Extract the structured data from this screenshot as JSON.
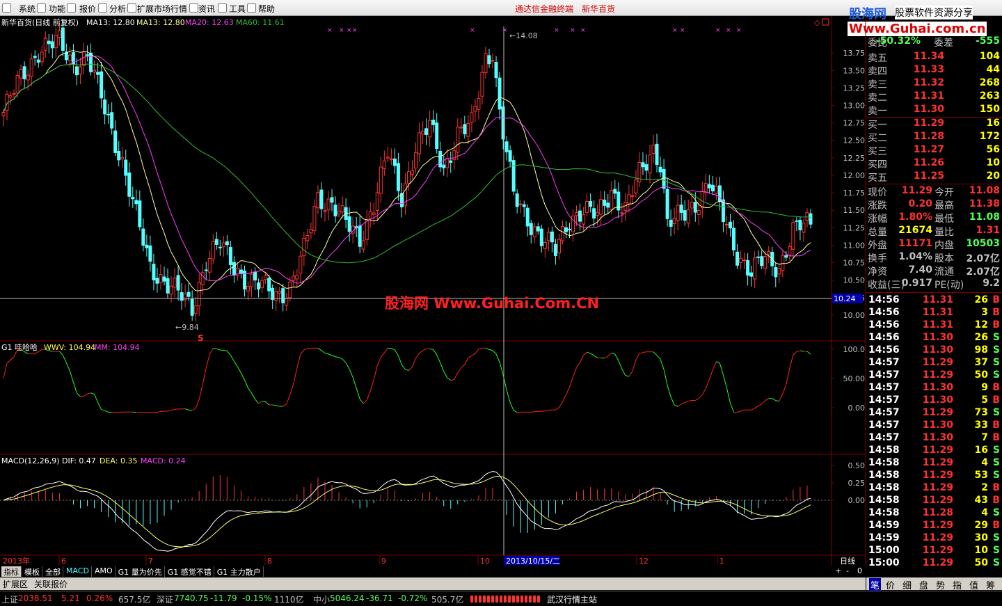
{
  "menu": {
    "items": [
      "系统",
      "功能",
      "报价",
      "分析",
      "扩展市场行情",
      "资讯",
      "工具",
      "帮助"
    ],
    "title": "通达信金融终端　新华百货"
  },
  "logo": {
    "brand": "股海网",
    "tag": "股票软件资源分享",
    "url": "Www.Guhai.com.cn",
    "watermark": "股海网 Www.Guhai.Com.CN"
  },
  "main_legend": {
    "stock": "新华百货(日线 前复权)",
    "ma1": "MA13: 12.80",
    "ma2": "MA13: 12.80",
    "ma3": "MA20: 12.63",
    "ma4": "MA60: 11.61"
  },
  "main_axis": [
    "13.75",
    "13.50",
    "13.25",
    "13.00",
    "12.75",
    "12.50",
    "12.25",
    "12.00",
    "11.75",
    "11.50",
    "11.25",
    "11.00",
    "10.75",
    "10.50",
    "10.25",
    "10.00"
  ],
  "main_marks": {
    "high": "14.08",
    "low": "9.84",
    "cross": "10.24",
    "s_sign": "S"
  },
  "ind1_legend": {
    "name": "G1 哇哈哈",
    "wwv": "WWV: 104.94",
    "mm": "MM: 104.94"
  },
  "ind1_axis": [
    "100.0",
    "50.00",
    "0.00"
  ],
  "macd_legend": {
    "name": "MACD(12,26,9)",
    "dif": "DIF: 0.47",
    "dea": "DEA: 0.35",
    "macd": "MACD: 0.24"
  },
  "macd_axis": [
    "0.50",
    "0.25",
    "0.00"
  ],
  "date_axis": {
    "year": "2013年",
    "months": [
      "6",
      "7",
      "8",
      "9",
      "10",
      "12",
      "1"
    ],
    "cursor": "2013/10/15/二",
    "period": "日线"
  },
  "tabs": [
    "指标",
    "模板",
    "全部",
    "MACD",
    "AMO",
    "G1 量为价先",
    "G1 感觉不错",
    "G1 主力散户"
  ],
  "tabs2": [
    "扩展区",
    "关联报价"
  ],
  "tab_controls": [
    "+",
    "-",
    "0"
  ],
  "quote": {
    "ratio": {
      "label": "委比",
      "value": "-50.32%",
      "label2": "委差",
      "value2": "-555"
    },
    "sells": [
      {
        "label": "卖五",
        "price": "11.34",
        "vol": "104"
      },
      {
        "label": "卖四",
        "price": "11.33",
        "vol": "44"
      },
      {
        "label": "卖三",
        "price": "11.32",
        "vol": "268"
      },
      {
        "label": "卖二",
        "price": "11.31",
        "vol": "263"
      },
      {
        "label": "卖一",
        "price": "11.30",
        "vol": "150"
      }
    ],
    "buys": [
      {
        "label": "买一",
        "price": "11.29",
        "vol": "16"
      },
      {
        "label": "买二",
        "price": "11.28",
        "vol": "172"
      },
      {
        "label": "买三",
        "price": "11.27",
        "vol": "56"
      },
      {
        "label": "买四",
        "price": "11.26",
        "vol": "10"
      },
      {
        "label": "买五",
        "price": "11.25",
        "vol": "20"
      }
    ],
    "stats": [
      {
        "l1": "现价",
        "v1": "11.29",
        "l2": "今开",
        "v2": "11.08"
      },
      {
        "l1": "涨跌",
        "v1": "0.20",
        "l2": "最高",
        "v2": "11.38"
      },
      {
        "l1": "涨幅",
        "v1": "1.80%",
        "l2": "最低",
        "v2": "11.08"
      },
      {
        "l1": "总量",
        "v1": "21674",
        "l2": "量比",
        "v2": "1.31"
      },
      {
        "l1": "外盘",
        "v1": "11171",
        "l2": "内盘",
        "v2": "10503"
      },
      {
        "l1": "换手",
        "v1": "1.04%",
        "l2": "股本",
        "v2": "2.07亿"
      },
      {
        "l1": "净资",
        "v1": "7.40",
        "l2": "流通",
        "v2": "2.07亿"
      },
      {
        "l1": "收益(三)",
        "v1": "0.917",
        "l2": "PE(动)",
        "v2": "9.2"
      }
    ],
    "ticks": [
      [
        "14:56",
        "11.31",
        "26",
        "B"
      ],
      [
        "14:56",
        "11.31",
        "3",
        "B"
      ],
      [
        "14:56",
        "11.31",
        "12",
        "B"
      ],
      [
        "14:56",
        "11.30",
        "26",
        "S"
      ],
      [
        "14:56",
        "11.30",
        "98",
        "S"
      ],
      [
        "14:57",
        "11.29",
        "37",
        "S"
      ],
      [
        "14:57",
        "11.29",
        "50",
        "S"
      ],
      [
        "14:57",
        "11.30",
        "9",
        "B"
      ],
      [
        "14:57",
        "11.30",
        "5",
        "B"
      ],
      [
        "14:57",
        "11.29",
        "73",
        "S"
      ],
      [
        "14:57",
        "11.30",
        "33",
        "B"
      ],
      [
        "14:57",
        "11.30",
        "7",
        "B"
      ],
      [
        "14:58",
        "11.29",
        "16",
        "S"
      ],
      [
        "14:58",
        "11.29",
        "4",
        "S"
      ],
      [
        "14:58",
        "11.29",
        "53",
        "S"
      ],
      [
        "14:58",
        "11.29",
        "2",
        "B"
      ],
      [
        "14:58",
        "11.29",
        "43",
        "B"
      ],
      [
        "14:58",
        "11.28",
        "4",
        "S"
      ],
      [
        "14:59",
        "11.29",
        "29",
        "B"
      ],
      [
        "14:59",
        "11.29",
        "30",
        "S"
      ],
      [
        "15:00",
        "11.29",
        "10",
        "S"
      ],
      [
        "15:00",
        "11.29",
        "50",
        "S"
      ]
    ]
  },
  "right_tabs": [
    "笔",
    "价",
    "细",
    "盘",
    "势",
    "指",
    "值",
    "筹"
  ],
  "status": {
    "sh": {
      "name": "上证",
      "value": "2038.51",
      "chg": "5.21",
      "pct": "0.26%",
      "amt": "657.5亿"
    },
    "sz": {
      "name": "深证",
      "value": "7740.75",
      "chg": "-11.79",
      "pct": "-0.15%",
      "amt": "1110亿"
    },
    "zx": {
      "name": "中小",
      "value": "5046.24",
      "chg": "-36.71",
      "pct": "-0.72%",
      "amt": "505.7亿"
    },
    "server": "武汉行情主站"
  },
  "colors": {
    "up": "#ff3232",
    "down": "#54ffff",
    "ma13": "#ffffa0",
    "ma20": "#ff40ff",
    "ma60": "#30c030",
    "grid": "#800000",
    "text": "#c0c0c0"
  },
  "chart_data": [
    {
      "type": "candlestick",
      "title": "新华百货(日线 前复权)",
      "ylim": [
        9.75,
        14.1
      ],
      "x_cursor": "2013/10/15/二",
      "anchors": [
        [
          0,
          12.9
        ],
        [
          4,
          13.3
        ],
        [
          10,
          13.8
        ],
        [
          16,
          13.9
        ],
        [
          20,
          13.6
        ],
        [
          24,
          13.7
        ],
        [
          28,
          13.1
        ],
        [
          34,
          12.2
        ],
        [
          38,
          11.4
        ],
        [
          42,
          10.7
        ],
        [
          46,
          10.5
        ],
        [
          50,
          10.3
        ],
        [
          54,
          10.1
        ],
        [
          58,
          10.8
        ],
        [
          62,
          11.0
        ],
        [
          66,
          10.7
        ],
        [
          70,
          10.5
        ],
        [
          74,
          10.4
        ],
        [
          78,
          10.3
        ],
        [
          82,
          10.4
        ],
        [
          86,
          10.9
        ],
        [
          90,
          11.7
        ],
        [
          94,
          11.6
        ],
        [
          98,
          11.3
        ],
        [
          102,
          11.1
        ],
        [
          106,
          11.6
        ],
        [
          110,
          12.3
        ],
        [
          114,
          11.7
        ],
        [
          118,
          12.4
        ],
        [
          122,
          12.7
        ],
        [
          126,
          12.1
        ],
        [
          130,
          12.6
        ],
        [
          134,
          12.7
        ],
        [
          138,
          13.7
        ],
        [
          140,
          13.8
        ],
        [
          142,
          12.9
        ],
        [
          146,
          11.7
        ],
        [
          150,
          11.4
        ],
        [
          154,
          11.1
        ],
        [
          158,
          10.9
        ],
        [
          162,
          11.4
        ],
        [
          166,
          11.5
        ],
        [
          170,
          11.4
        ],
        [
          174,
          11.8
        ],
        [
          178,
          11.5
        ],
        [
          182,
          12.0
        ],
        [
          186,
          12.4
        ],
        [
          188,
          12.2
        ],
        [
          190,
          11.3
        ],
        [
          194,
          11.4
        ],
        [
          198,
          11.6
        ],
        [
          202,
          11.9
        ],
        [
          206,
          11.4
        ],
        [
          210,
          10.9
        ],
        [
          214,
          10.6
        ],
        [
          218,
          10.8
        ],
        [
          222,
          10.7
        ],
        [
          226,
          11.2
        ],
        [
          230,
          11.3
        ]
      ]
    },
    {
      "type": "line",
      "title": "G1 哇哈哈",
      "ylim": [
        -50,
        110
      ],
      "series": [
        {
          "name": "WWV",
          "values": [
            104.94
          ]
        },
        {
          "name": "MM",
          "values": [
            104.94
          ]
        }
      ]
    },
    {
      "type": "bar",
      "title": "MACD(12,26,9)",
      "ylim": [
        -0.65,
        0.6
      ],
      "series": [
        {
          "name": "DIF",
          "values": [
            0.47
          ]
        },
        {
          "name": "DEA",
          "values": [
            0.35
          ]
        },
        {
          "name": "MACD",
          "values": [
            0.24
          ]
        }
      ]
    }
  ]
}
